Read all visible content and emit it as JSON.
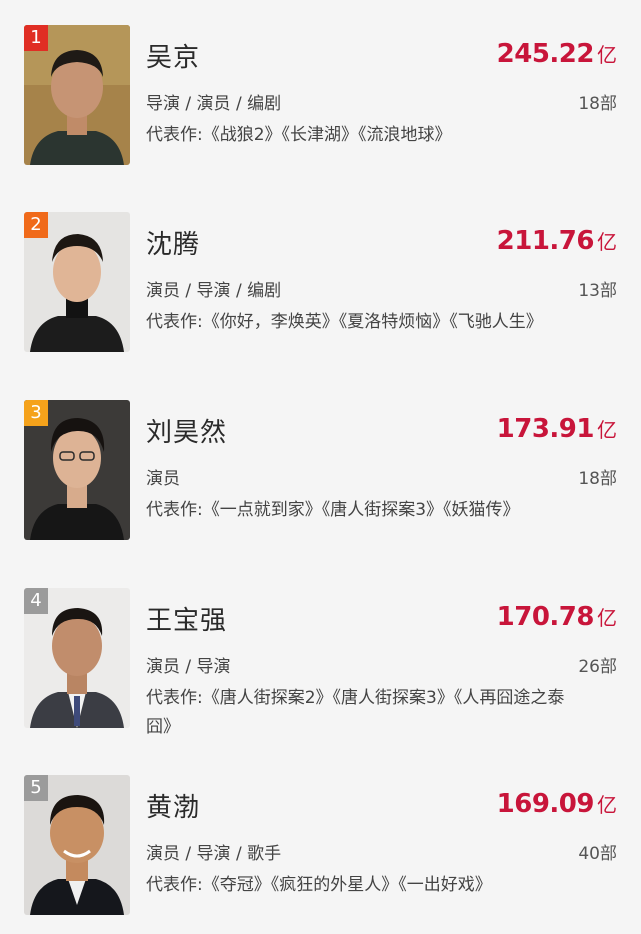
{
  "list": {
    "items": [
      {
        "rank": "1",
        "name": "吴京",
        "box_office": "245.22",
        "unit": "亿",
        "roles": "导演 / 演员 / 编剧",
        "film_count": "18部",
        "works": "代表作:《战狼2》《长津湖》《流浪地球》",
        "badge_color": "#e02e24"
      },
      {
        "rank": "2",
        "name": "沈腾",
        "box_office": "211.76",
        "unit": "亿",
        "roles": "演员 / 导演 / 编剧",
        "film_count": "13部",
        "works": "代表作:《你好，李焕英》《夏洛特烦恼》《飞驰人生》",
        "badge_color": "#f06a1a"
      },
      {
        "rank": "3",
        "name": "刘昊然",
        "box_office": "173.91",
        "unit": "亿",
        "roles": "演员",
        "film_count": "18部",
        "works": "代表作:《一点就到家》《唐人街探案3》《妖猫传》",
        "badge_color": "#f5a21b"
      },
      {
        "rank": "4",
        "name": "王宝强",
        "box_office": "170.78",
        "unit": "亿",
        "roles": "演员 / 导演",
        "film_count": "26部",
        "works": "代表作:《唐人街探案2》《唐人街探案3》《人再囧途之泰囧》",
        "badge_color": "#9b9b9b"
      },
      {
        "rank": "5",
        "name": "黄渤",
        "box_office": "169.09",
        "unit": "亿",
        "roles": "演员 / 导演 / 歌手",
        "film_count": "40部",
        "works": "代表作:《夺冠》《疯狂的外星人》《一出好戏》",
        "badge_color": "#9b9b9b"
      }
    ]
  }
}
